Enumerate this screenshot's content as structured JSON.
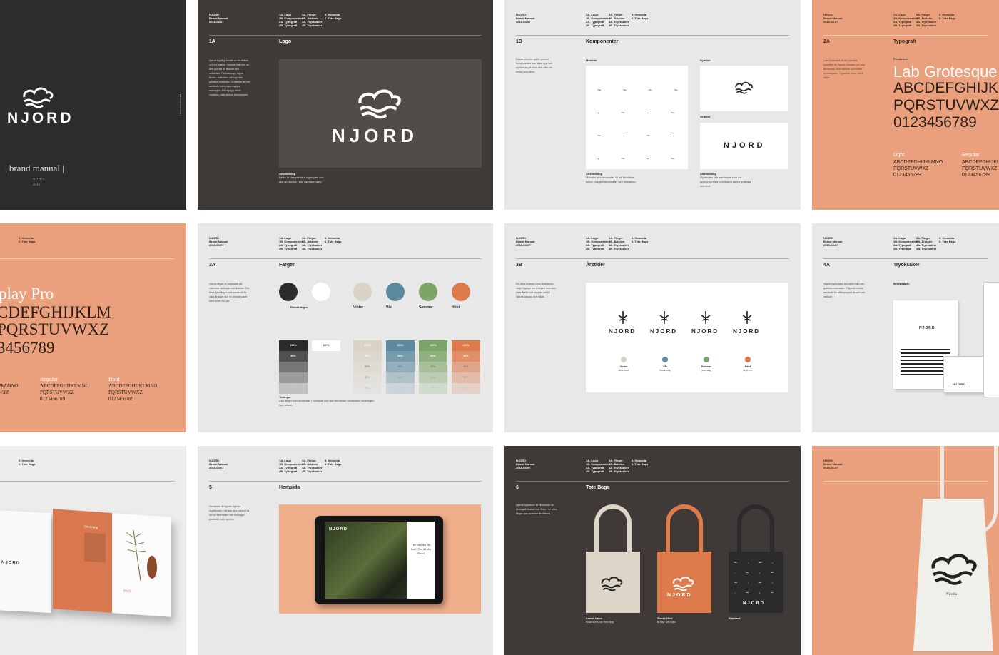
{
  "brand": {
    "name": "NJORD",
    "manual_label": "| brand manual |",
    "month": "APRIL",
    "year": "2016",
    "date_header": "NJORD\nBrand Manual\n2016-04-07"
  },
  "nav": {
    "col1": "1A. Logo\n1B. Komponenter\n2A. Typografi\n2B. Typografi",
    "col2": "3A. Färger\n3B. Årstider\n4A. Trycksaker\n4B. Trycksaker",
    "col3": "5. Hemsida\n6. Tote Bags"
  },
  "p_logo": {
    "section_id": "1A",
    "section_title": "Logo",
    "body": "Njords logotyp bestär av ett tecken och en ordbild. Formen mår mer än den gör lott av tecknet och ordbilden. För massupp tagna texten, ordbilden och lagt den primära versionen. Ordbilden är mer används i den ursprungliga ordningen. Ett logotyp för en variation, utan tecken förekommer.",
    "note_title": "Användning",
    "note_body": "Detta är den primära logotypen och ska användas i alla sammanhang."
  },
  "p_comp": {
    "section_id": "1B",
    "section_title": "Komponenter",
    "body": "Dessa mönster gäller genom komponenter kan delas upp och appliceras på olika sätt, efter de behov som finns.",
    "pattern_label": "Mönster",
    "symbol_label": "Symbol",
    "wordmark_label": "Ordbild",
    "note_a_title": "Användning",
    "note_a_body": "Mönster ska användas till att förstärka dekor bakgrundsmönster och förstärker.",
    "note_b_title": "Användning",
    "note_b_body": "Symbolen ska användas som en faviconsymbol och ibland andra grafiska element."
  },
  "p_typo1": {
    "section_id": "2A",
    "section_title": "Typografi",
    "label": "Primärtext",
    "font_name": "Lab Grotesque",
    "upper1": "ABCDEFGHIJKLMNO",
    "upper2": "PQRSTUVWXZ",
    "digits": "0123456789",
    "body": "Lab Grotesque är det primära typsnittet för Njords identitet och ska användas i alla rubriker och större textmängder. Typsnittet finns i flera vikter.",
    "weight1": "Light",
    "weight2": "Regular",
    "w_upper1": "ABCDEFGHIJKLMNO",
    "w_upper2": "PQRSTUVWXZ",
    "w_digits": "0123456789"
  },
  "p_typo2": {
    "font_name": "play Pro",
    "upper1": "CDEFGHIJKLM",
    "upper2": "PQRSTUVWXZ",
    "digits": "3456789",
    "weight1": "Regular",
    "weight2": "Bold",
    "w_upper1": "ABCDEFGHIJKLMNO",
    "w_upper2": "PQRSTUVWXZ",
    "w_digits": "0123456789",
    "italic1": "JKLMNO",
    "italic2": "WXZ",
    "nav": "5. Hemsida\n6. Tote Bags"
  },
  "p_colors": {
    "section_id": "3A",
    "section_title": "Färger",
    "body": "Njords färger är baserade på naturens växlingar och årstider. Det finns fyra färger som används för olika årstider och en primär palett med svart och vitt.",
    "primary_label": "Primärfärger",
    "seasons": [
      {
        "name": "Vinter",
        "color": "#d9d3c6"
      },
      {
        "name": "Vår",
        "color": "#5b8a9e"
      },
      {
        "name": "Sommar",
        "color": "#7ca467"
      },
      {
        "name": "Höst",
        "color": "#de7b4c"
      }
    ],
    "tints": [
      "100%",
      "80%",
      "60%",
      "40%",
      "20%"
    ],
    "note_title": "Toningar",
    "note_body": "Alla färger kan användas i toningar och ska förväntas användas i ordningen som visas."
  },
  "p_seasons": {
    "section_id": "3B",
    "section_title": "Årstider",
    "body": "De olika tecknen visar årstiderna. Varje logotyp har en egen ikon som visar årstid och kopplar det till Njords känslor och miljön.",
    "seasons": [
      {
        "name": "Vinter",
        "sub": "december"
      },
      {
        "name": "Vår",
        "sub": "mars–maj"
      },
      {
        "name": "Sommar",
        "sub": "juni–aug"
      },
      {
        "name": "Höst",
        "sub": "sept–nov"
      }
    ]
  },
  "p_print": {
    "section_id": "4A",
    "section_title": "Trycksaker",
    "body": "Njords trycksaker ska alltid följa den grafiska manualen. Följande mallar används för affärspapper, kuvert och visitkort.",
    "label_a": "Brevpapper",
    "label_b": "Kuvert"
  },
  "p_booklet": {
    "nav": "5. Hemsida\n6. Tote Bags",
    "left_title": "NJORD",
    "page_title": "Inledning",
    "caption": "dryck"
  },
  "p_web": {
    "section_id": "5",
    "section_title": "Hemsida",
    "body": "Hemsidan är Njords digitala skyltfönster. Här kan alla som vill ta del av information om företaget, produkter och nyheter.",
    "poem": "I en vind ska blir kraft. Om det ska eller så",
    "tagline": "NJORD"
  },
  "p_tote": {
    "section_id": "6",
    "section_title": "Tote Bags",
    "body": "Njords tygkassar är tillverkade av ekologisk bomull och finns i tre olika färger som matchar årstiderna.",
    "bags": [
      {
        "caption": "Ämnd: Natur",
        "sub": "Eklar och kulor med färg"
      },
      {
        "caption": "Ämnd: Höst",
        "sub": "Brodyr och tryck"
      },
      {
        "caption": "Standard",
        "sub": ""
      }
    ]
  },
  "p_bag": {
    "label": "Njordia"
  }
}
